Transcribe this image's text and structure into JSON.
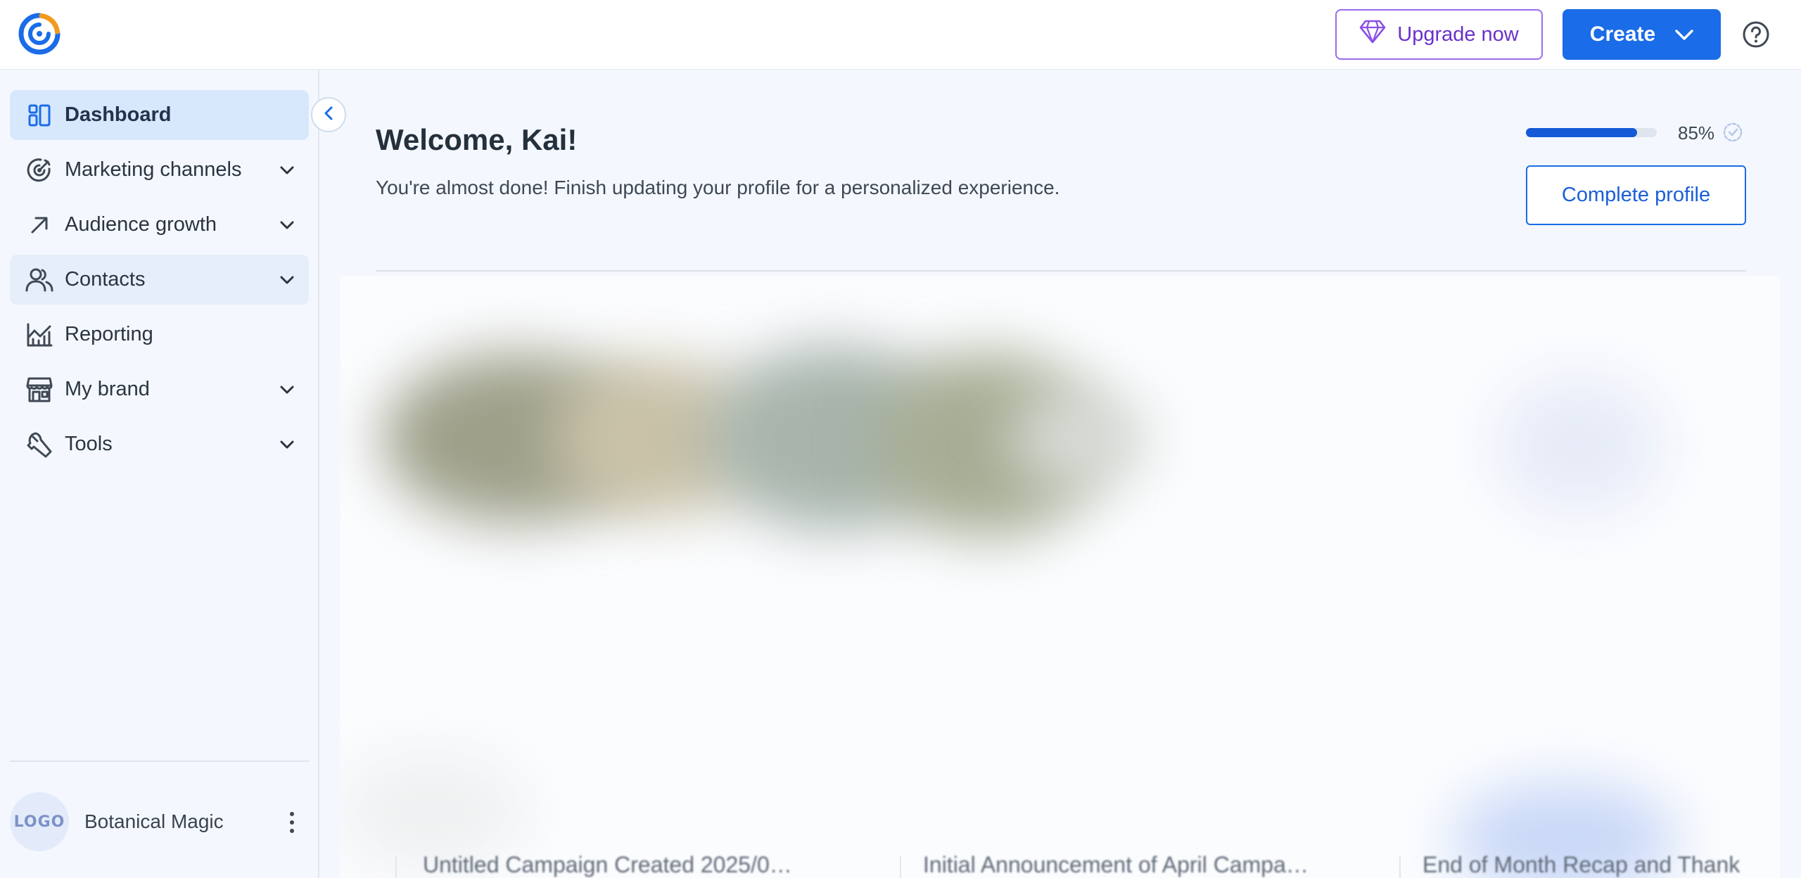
{
  "topbar": {
    "upgrade_label": "Upgrade now",
    "create_label": "Create"
  },
  "sidebar": {
    "items": [
      {
        "label": "Dashboard",
        "icon": "dashboard-icon",
        "expandable": false,
        "state": "active"
      },
      {
        "label": "Marketing channels",
        "icon": "target-icon",
        "expandable": true,
        "state": ""
      },
      {
        "label": "Audience growth",
        "icon": "arrow-up-right-icon",
        "expandable": true,
        "state": ""
      },
      {
        "label": "Contacts",
        "icon": "people-icon",
        "expandable": true,
        "state": "hover"
      },
      {
        "label": "Reporting",
        "icon": "chart-icon",
        "expandable": false,
        "state": ""
      },
      {
        "label": "My brand",
        "icon": "storefront-icon",
        "expandable": true,
        "state": ""
      },
      {
        "label": "Tools",
        "icon": "wrench-icon",
        "expandable": true,
        "state": ""
      }
    ],
    "account": {
      "avatar_text": "LOGO",
      "name": "Botanical Magic"
    }
  },
  "main": {
    "welcome": "Welcome, Kai!",
    "subtext": "You're almost done! Finish updating your profile for a personalized experience.",
    "progress": {
      "value": 0.85,
      "label": "85%"
    },
    "complete_profile_label": "Complete profile",
    "cards": [
      {
        "title": "Untitled Campaign Created 2025/0…"
      },
      {
        "title": "Initial Announcement of April Campa…"
      },
      {
        "title": "End of Month Recap and Thank"
      }
    ]
  },
  "colors": {
    "accent": "#1a6ce8",
    "upgrade": "#6a31c9",
    "active_nav": "#d7e7fc",
    "page_bg": "#f4f8fe"
  }
}
